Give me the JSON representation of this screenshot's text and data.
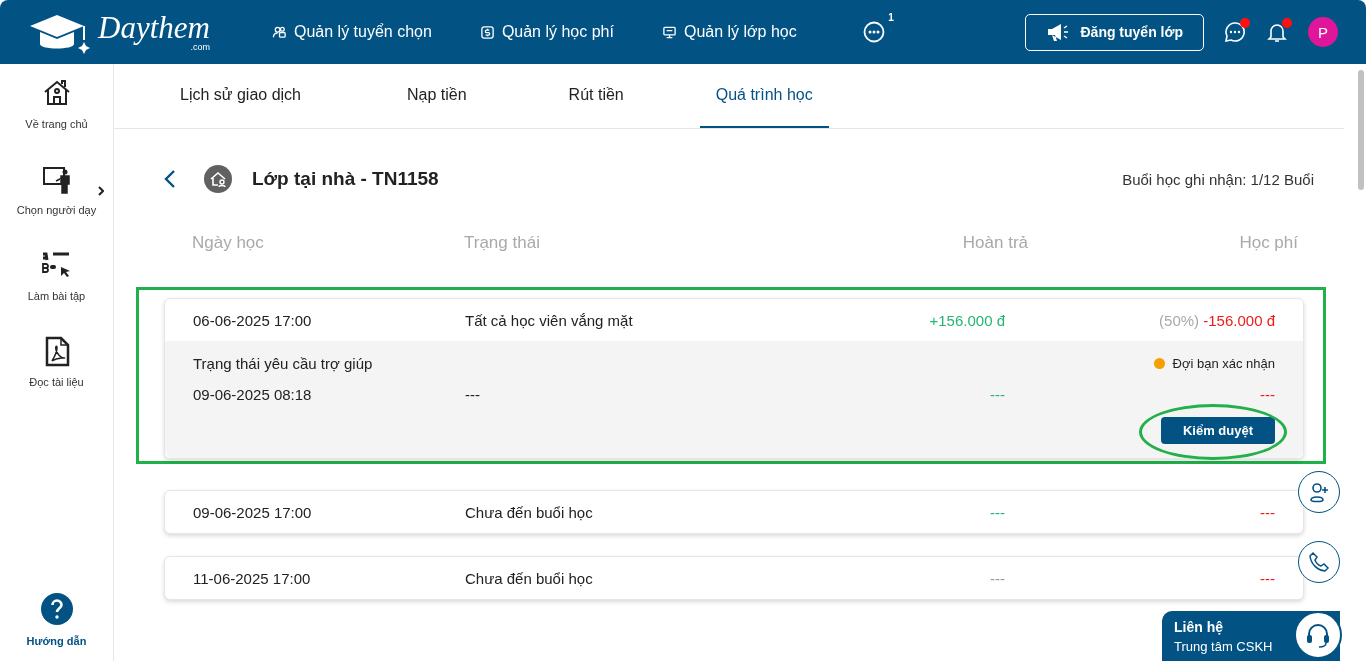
{
  "logo": {
    "name": "Daythem",
    "suffix": ".com"
  },
  "nav": [
    {
      "label": "Quản lý tuyển chọn",
      "kind": "people"
    },
    {
      "label": "Quản lý học phí",
      "kind": "money"
    },
    {
      "label": "Quản lý lớp học",
      "kind": "board"
    }
  ],
  "more": {
    "badge": "1"
  },
  "post_button": "Đăng tuyển lớp",
  "chat": {
    "unread": true
  },
  "bell": {
    "unread": true
  },
  "avatar": "P",
  "sidebar": [
    {
      "label": "Về trang chủ",
      "kind": "home",
      "has_submenu": false
    },
    {
      "label": "Chọn người dạy",
      "kind": "teacher",
      "has_submenu": true
    },
    {
      "label": "Làm bài tập",
      "kind": "quiz",
      "has_submenu": false
    },
    {
      "label": "Đọc tài liệu",
      "kind": "pdf",
      "has_submenu": false
    }
  ],
  "help": "Hướng dẫn",
  "tabs": [
    {
      "label": "Lịch sử giao dịch",
      "selected": false
    },
    {
      "label": "Nạp tiền",
      "selected": false
    },
    {
      "label": "Rút tiền",
      "selected": false
    },
    {
      "label": "Quá trình học",
      "selected": true
    }
  ],
  "header": {
    "title": "Lớp tại nhà - TN1158",
    "summary": "Buổi học ghi nhận: 1/12 Buổi"
  },
  "columns": [
    "Ngày học",
    "Trạng thái",
    "Hoàn trả",
    "Học phí"
  ],
  "sessions": [
    {
      "date": "06-06-2025 17:00",
      "status": "Tất cả học viên vắng mặt",
      "refund": "+156.000 đ",
      "color": "#22b573",
      "percent": "(50%)",
      "fee": "-156.000 đ",
      "expanded": true,
      "detail": {
        "title": "Trạng thái yêu cầu trợ giúp",
        "status_label": "Đợi bạn xác nhận",
        "color": "#f5a000",
        "date": "09-06-2025 08:18",
        "status": "---",
        "refund": "---",
        "fee": "---",
        "action": "Kiểm duyệt"
      }
    },
    {
      "date": "09-06-2025 17:00",
      "status": "Chưa đến buổi học",
      "refund": "---",
      "color": "#22b573",
      "fee": "---",
      "expanded": false
    },
    {
      "date": "11-06-2025 17:00",
      "status": "Chưa đến buổi học",
      "refund": "---",
      "color": "#9a9a9a",
      "fee": "---",
      "expanded": false
    }
  ],
  "contact": {
    "title": "Liên hệ",
    "subtitle": "Trung tâm CSKH"
  }
}
